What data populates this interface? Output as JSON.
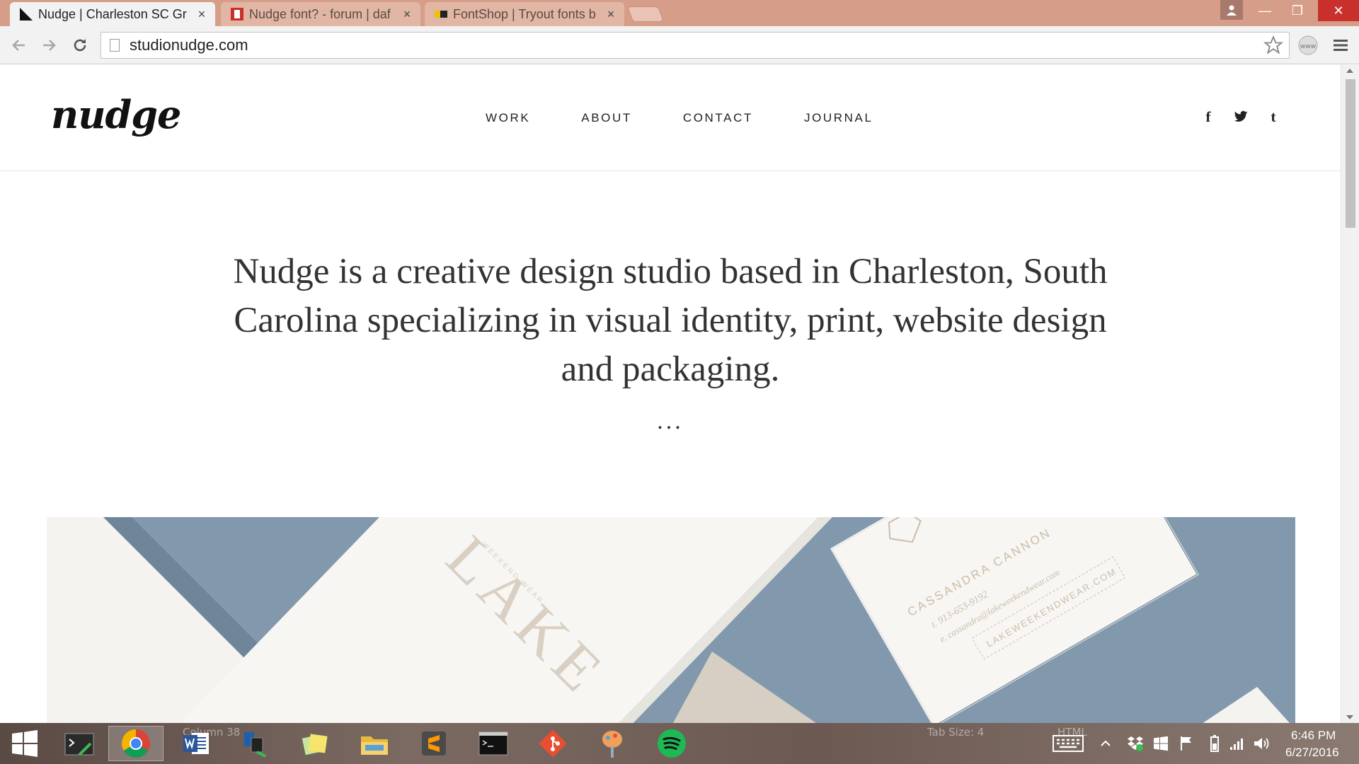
{
  "browser": {
    "tabs": [
      {
        "title": "Nudge | Charleston SC Gr",
        "active": true
      },
      {
        "title": "Nudge font? - forum | daf",
        "active": false
      },
      {
        "title": "FontShop | Tryout fonts b",
        "active": false
      }
    ],
    "close_glyph": "×",
    "url": "studionudge.com",
    "window_controls": {
      "minimize": "—",
      "maximize": "❐",
      "close": "✕"
    },
    "extension_label": "www"
  },
  "site": {
    "logo": "nudge",
    "nav": [
      "WORK",
      "ABOUT",
      "CONTACT",
      "JOURNAL"
    ],
    "social_icons": [
      "facebook-icon",
      "twitter-icon",
      "tumblr-icon"
    ],
    "social_glyphs": {
      "facebook": "f",
      "tumblr": "t"
    },
    "intro": "Nudge is a creative design studio based in Charleston, South Carolina specializing in visual identity, print, website design and packaging.",
    "ellipsis": "...",
    "hero": {
      "card_left_brand": "LAKE",
      "card_left_sub": "WEEKEND WEAR",
      "card_right_name": "CASSANDRA CANNON",
      "card_right_phone": "t. 913-653-9192",
      "card_right_email": "e. cassandra@lakeweekendwear.com",
      "card_right_site": "LAKEWEEKENDWEAR.COM"
    },
    "colors": {
      "hero_blue": "#8299ad",
      "card_white": "#f7f6f3",
      "kraft": "#d8cfc4"
    }
  },
  "taskbar": {
    "apps": [
      "windows-start-icon",
      "terminal-app-icon",
      "chrome-icon",
      "word-icon",
      "network-app-icon",
      "sticky-notes-icon",
      "file-explorer-icon",
      "sublime-text-icon",
      "cmd-icon",
      "git-icon",
      "paint-app-icon",
      "spotify-icon"
    ],
    "background_text": {
      "tab_size": "Tab Size: 4",
      "html": "HTML",
      "column": "Column 38"
    },
    "clock_time": "6:46 PM",
    "clock_date": "6/27/2016"
  }
}
